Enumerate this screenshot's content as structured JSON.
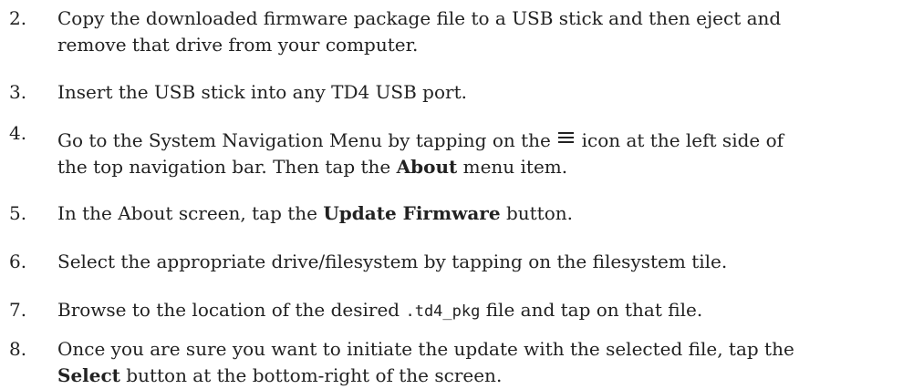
{
  "steps": [
    {
      "number": "2.",
      "line1": "Copy the downloaded firmware package file to a USB stick and then eject and",
      "line2": "remove that drive from your computer."
    },
    {
      "number": "3.",
      "text": "Insert the USB stick into any TD4 USB port."
    },
    {
      "number": "4.",
      "line1_before": "Go to the System Navigation Menu by tapping on the",
      "icon": "hamburger-menu-icon",
      "line1_after": "icon at the left side of",
      "line2_before": "the top navigation bar. Then tap the",
      "line2_bold": "About",
      "line2_after": "menu item."
    },
    {
      "number": "5.",
      "before": "In the About screen, tap the",
      "bold": "Update Firmware",
      "after": "button."
    },
    {
      "number": "6.",
      "text": "Select the appropriate drive/filesystem by tapping on the filesystem tile."
    },
    {
      "number": "7.",
      "before": "Browse to the location of the desired",
      "code": ".td4_pkg",
      "after": "file and tap on that file."
    },
    {
      "number": "8.",
      "line1": "Once you are sure you want to initiate the update with the selected file, tap the",
      "line2_bold": "Select",
      "line2_after": "button at the bottom-right of the screen."
    }
  ]
}
